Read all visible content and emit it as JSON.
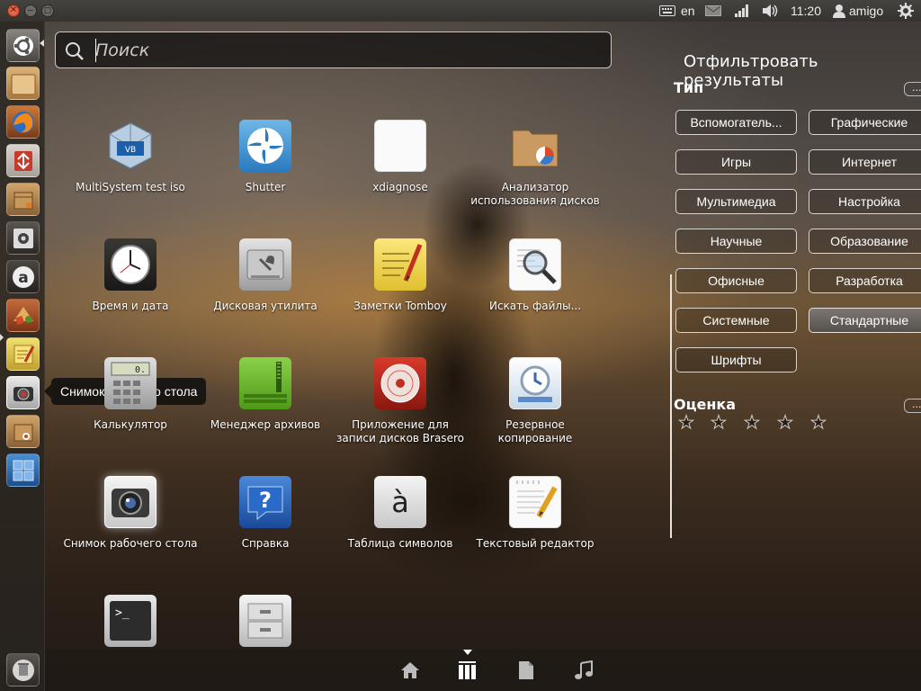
{
  "top_panel": {
    "window_buttons": {
      "close": "✕",
      "minimize": "–",
      "maximize": "◻"
    },
    "keyboard_layout": "en",
    "time": "11:20",
    "user": "amigo",
    "icons": [
      "keyboard-icon",
      "mail-icon",
      "network-icon",
      "volume-icon",
      "user-icon",
      "gear-icon"
    ]
  },
  "launcher": {
    "items": [
      {
        "name": "dash-home",
        "icon": "ubuntu-icon"
      },
      {
        "name": "home-folder",
        "icon": "folder-icon"
      },
      {
        "name": "firefox",
        "icon": "firefox-icon"
      },
      {
        "name": "synaptic",
        "icon": "package-manager-icon"
      },
      {
        "name": "software-center",
        "icon": "software-box-icon"
      },
      {
        "name": "settings",
        "icon": "settings-icon"
      },
      {
        "name": "amigo",
        "icon": "amigo-a-icon"
      },
      {
        "name": "games",
        "icon": "games-icon"
      },
      {
        "name": "tomboy",
        "icon": "notes-icon"
      },
      {
        "name": "screenshot",
        "icon": "camera-icon"
      },
      {
        "name": "installer",
        "icon": "installer-box-icon"
      },
      {
        "name": "workspaces",
        "icon": "workspace-switcher-icon"
      },
      {
        "name": "trash",
        "icon": "trash-icon"
      }
    ],
    "tooltip": "Снимок рабочего стола"
  },
  "search": {
    "placeholder": "Поиск",
    "value": ""
  },
  "apps": [
    {
      "label": "MultiSystem test iso",
      "icon": "virtualbox-icon"
    },
    {
      "label": "Shutter",
      "icon": "shutter-icon"
    },
    {
      "label": "xdiagnose",
      "icon": "blank-app-icon"
    },
    {
      "label": "Анализатор использования дисков",
      "icon": "disk-usage-folder-icon"
    },
    {
      "label": "Время и дата",
      "icon": "clock-icon"
    },
    {
      "label": "Дисковая утилита",
      "icon": "disk-utility-icon"
    },
    {
      "label": "Заметки Tomboy",
      "icon": "tomboy-notes-icon"
    },
    {
      "label": "Искать файлы...",
      "icon": "search-files-icon"
    },
    {
      "label": "Калькулятор",
      "icon": "calculator-icon"
    },
    {
      "label": "Менеджер архивов",
      "icon": "archive-manager-icon"
    },
    {
      "label": "Приложение для записи дисков Brasero",
      "icon": "brasero-disc-icon"
    },
    {
      "label": "Резервное копирование",
      "icon": "backup-icon"
    },
    {
      "label": "Снимок рабочего стола",
      "icon": "screenshot-camera-icon"
    },
    {
      "label": "Справка",
      "icon": "help-icon"
    },
    {
      "label": "Таблица символов",
      "icon": "character-map-icon"
    },
    {
      "label": "Текстовый редактор",
      "icon": "text-editor-icon"
    },
    {
      "label": "",
      "icon": "terminal-icon"
    },
    {
      "label": "",
      "icon": "file-cabinet-icon"
    }
  ],
  "filter": {
    "title": "Отфильтровать результаты",
    "type_section": "Тип",
    "more": "...",
    "categories": [
      {
        "label": "Вспомогатель...",
        "selected": false
      },
      {
        "label": "Графические",
        "selected": false
      },
      {
        "label": "Игры",
        "selected": false
      },
      {
        "label": "Интернет",
        "selected": false
      },
      {
        "label": "Мультимедиа",
        "selected": false
      },
      {
        "label": "Настройка",
        "selected": false
      },
      {
        "label": "Научные",
        "selected": false
      },
      {
        "label": "Образование",
        "selected": false
      },
      {
        "label": "Офисные",
        "selected": false
      },
      {
        "label": "Разработка",
        "selected": false
      },
      {
        "label": "Системные",
        "selected": false
      },
      {
        "label": "Стандартные",
        "selected": true
      },
      {
        "label": "Шрифты",
        "selected": false
      }
    ],
    "rating_section": "Оценка",
    "rating_stars": 5,
    "star_glyph": "★"
  },
  "lenses": [
    {
      "name": "home",
      "icon": "home-icon",
      "active": false
    },
    {
      "name": "applications",
      "icon": "applications-icon",
      "active": true
    },
    {
      "name": "files",
      "icon": "file-icon",
      "active": false
    },
    {
      "name": "music",
      "icon": "music-icon",
      "active": false
    }
  ],
  "colors": {
    "accent_close": "#e5583a",
    "chip_border": "#d8d4cf",
    "selected_chip": "#6b6662"
  }
}
